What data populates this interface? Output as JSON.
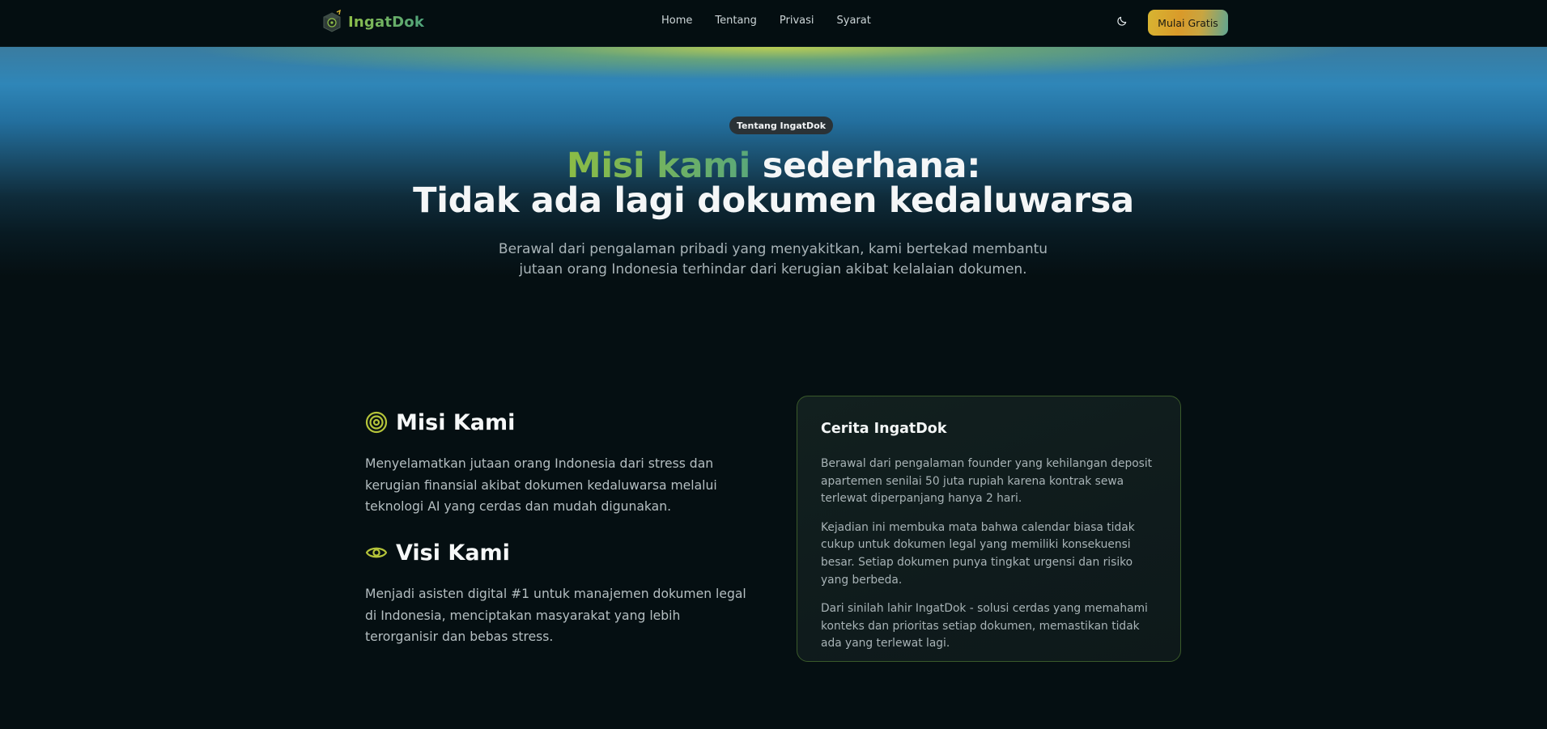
{
  "nav": {
    "brand": "IngatDok",
    "links": [
      "Home",
      "Tentang",
      "Privasi",
      "Syarat"
    ],
    "cta_label": "Mulai Gratis",
    "theme_toggle_icon": "moon-icon"
  },
  "hero": {
    "badge": "Tentang IngatDok",
    "title_accent": "Misi kami",
    "title_rest": " sederhana:",
    "title_line2": "Tidak ada lagi dokumen kedaluwarsa",
    "subtitle": "Berawal dari pengalaman pribadi yang menyakitkan, kami bertekad membantu jutaan orang Indonesia terhindar dari kerugian akibat kelalaian dokumen."
  },
  "mission": {
    "icon": "target-icon",
    "title": "Misi Kami",
    "text": "Menyelamatkan jutaan orang Indonesia dari stress dan kerugian finansial akibat dokumen kedaluwarsa melalui teknologi AI yang cerdas dan mudah digunakan."
  },
  "vision": {
    "icon": "eye-icon",
    "title": "Visi Kami",
    "text": "Menjadi asisten digital #1 untuk manajemen dokumen legal di Indonesia, menciptakan masyarakat yang lebih terorganisir dan bebas stress."
  },
  "story": {
    "title": "Cerita IngatDok",
    "paragraphs": [
      "Berawal dari pengalaman founder yang kehilangan deposit apartemen senilai 50 juta rupiah karena kontrak sewa terlewat diperpanjang hanya 2 hari.",
      "Kejadian ini membuka mata bahwa calendar biasa tidak cukup untuk dokumen legal yang memiliki konsekuensi besar. Setiap dokumen punya tingkat urgensi dan risiko yang berbeda.",
      "Dari sinilah lahir IngatDok - solusi cerdas yang memahami konteks dan prioritas setiap dokumen, memastikan tidak ada yang terlewat lagi."
    ]
  },
  "colors": {
    "background": "#050f12",
    "accent_green": "#8cbc45",
    "accent_teal": "#5aa87a",
    "cta_gold": "#d7b532",
    "card_border": "#3a5a2a"
  }
}
